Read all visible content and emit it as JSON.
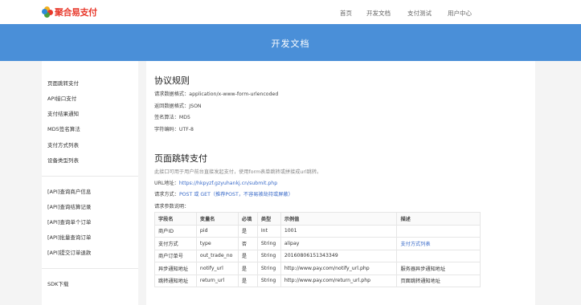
{
  "brand": {
    "logo_text": "聚合易支付"
  },
  "topnav": {
    "items": [
      "首页",
      "开发文档",
      "支付测试",
      "用户中心"
    ]
  },
  "hero": {
    "title": "开发文档"
  },
  "sidebar": {
    "group1": [
      "页面跳转支付",
      "API接口支付",
      "支付结果通知",
      "MD5签名算法",
      "支付方式列表",
      "设备类型列表"
    ],
    "group2": [
      "[API]查询商户信息",
      "[API]查询结算记录",
      "[API]查询单个订单",
      "[API]批量查询订单",
      "[API]提交订单退款"
    ],
    "group3": [
      "SDK下载"
    ]
  },
  "protocol": {
    "title": "协议规则",
    "lines": [
      "请求数据格式：application/x-www-form-urlencoded",
      "返回数据格式：JSON",
      "签名算法：MD5",
      "字符编码：UTF-8"
    ]
  },
  "redirect_pay": {
    "title": "页面跳转支付",
    "description": "此接口可用于用户前台直接发起支付，使用form表单跳转或拼接成url跳转。",
    "url_label": "URL地址：",
    "url": "https://hkpyzf.gzyuhankj.cn/submit.php",
    "method_label": "请求方式：",
    "method_value": "POST 或 GET（推荐POST，不容易被劫持或屏蔽）",
    "params_label": "请求参数说明："
  },
  "params_table": {
    "headers": [
      "字段名",
      "变量名",
      "必填",
      "类型",
      "示例值",
      "描述"
    ],
    "rows": [
      [
        "商户ID",
        "pid",
        "是",
        "Int",
        "1001",
        ""
      ],
      [
        "支付方式",
        "type",
        "否",
        "String",
        "alipay",
        "支付方式列表"
      ],
      [
        "商户订单号",
        "out_trade_no",
        "是",
        "String",
        "20160806151343349",
        ""
      ],
      [
        "异步通知地址",
        "notify_url",
        "是",
        "String",
        "http://www.pay.com/notify_url.php",
        "服务器异步通知地址"
      ],
      [
        "跳转通知地址",
        "return_url",
        "是",
        "String",
        "http://www.pay.com/return_url.php",
        "页面跳转通知地址"
      ]
    ]
  },
  "colors": {
    "hero": "#4a8fd8",
    "link": "#3a6bc9",
    "brand_red": "#e8382b"
  }
}
